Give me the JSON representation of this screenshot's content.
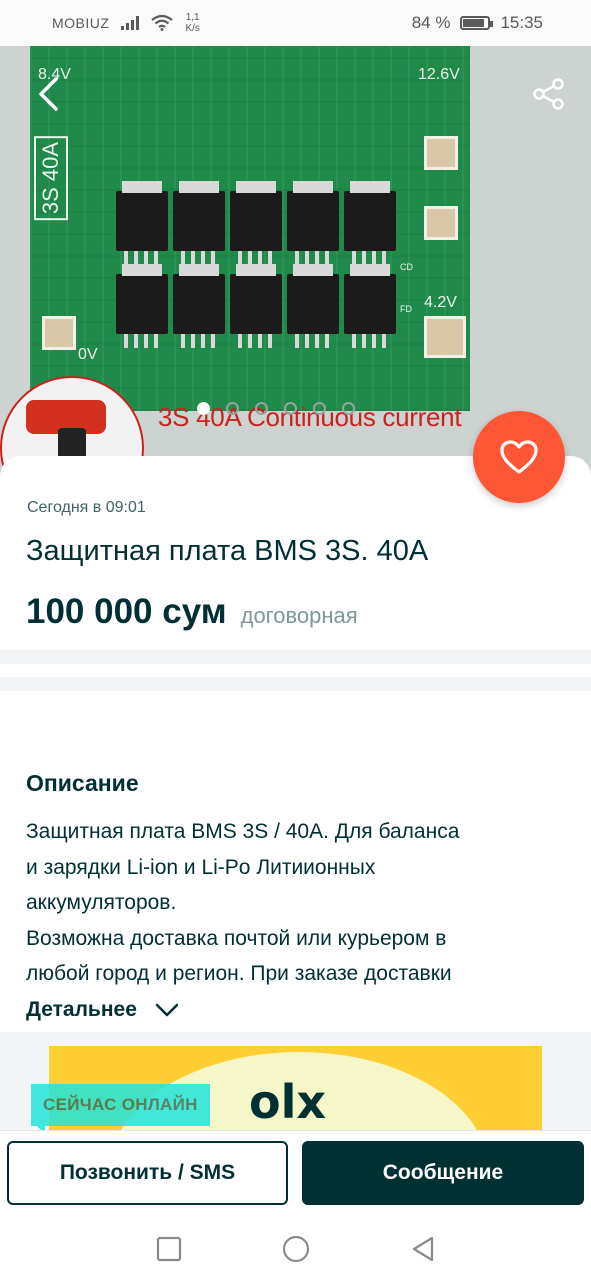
{
  "status_bar": {
    "carrier": "MOBIUZ",
    "speed_value": "1,1",
    "speed_unit": "K/s",
    "battery": "84 %",
    "battery_level": 0.84,
    "time": "15:35"
  },
  "hero": {
    "pcb_side_label": "3S 40A",
    "pcb_labels": [
      "8.4V",
      "12.6V",
      "4.2V",
      "0V",
      "CD",
      "FD"
    ],
    "caption": "3S 40A Continuous current",
    "image_count": 6,
    "active_image": 1
  },
  "listing": {
    "posted": "Сегодня в 09:01",
    "title": "Защитная плата BMS 3S. 40A",
    "price": "100 000 сум",
    "negotiable": "договорная"
  },
  "description": {
    "heading": "Описание",
    "lines": [
      "Защитная плата BMS 3S / 40A. Для баланса",
      "и зарядки Li-ion и Li-Po Литиионных",
      "аккумуляторов.",
      "Возможна доставка почтой или курьером в",
      "любой город и регион. При заказе доставки"
    ],
    "more": "Детальнее"
  },
  "banner": {
    "badge": "СЕЙЧАС ОНЛАЙН",
    "logo": "olx"
  },
  "actions": {
    "call": "Позвонить / SMS",
    "message": "Сообщение"
  },
  "colors": {
    "brand_dark": "#002f34",
    "favorite": "#ff5636",
    "online": "#23e5db"
  },
  "icons": [
    "back-arrow-icon",
    "share-icon",
    "heart-icon",
    "chevron-down-icon",
    "square-nav-icon",
    "circle-nav-icon",
    "triangle-back-nav-icon"
  ]
}
